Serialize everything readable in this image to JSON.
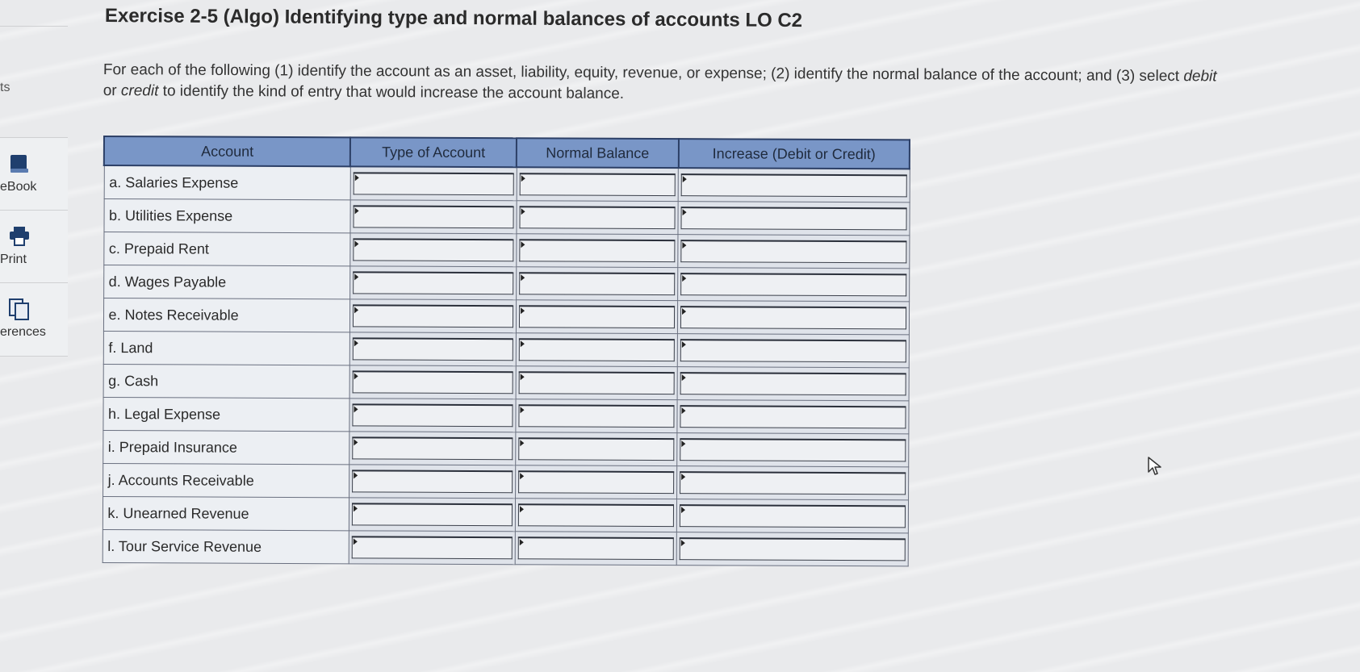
{
  "sidebar": {
    "cut_label_top": "ts",
    "items": [
      {
        "label": "eBook",
        "icon": "book-icon"
      },
      {
        "label": "Print",
        "icon": "printer-icon"
      },
      {
        "label": "erences",
        "icon": "references-icon"
      }
    ]
  },
  "exercise": {
    "title": "Exercise 2-5 (Algo) Identifying type and normal balances of accounts LO C2",
    "instructions_part1": "For each of the following (1) identify the account as an asset, liability, equity, revenue, or expense; (2) identify the normal balance of the account; and (3) select ",
    "instructions_debit": "debit",
    "instructions_or": " or ",
    "instructions_credit": "credit",
    "instructions_part2": " to identify the kind of entry that would increase the account balance."
  },
  "table": {
    "headers": [
      "Account",
      "Type of Account",
      "Normal Balance",
      "Increase (Debit or Credit)"
    ],
    "rows": [
      {
        "account": "a. Salaries Expense",
        "type": "",
        "normal": "",
        "increase": ""
      },
      {
        "account": "b. Utilities Expense",
        "type": "",
        "normal": "",
        "increase": ""
      },
      {
        "account": "c. Prepaid Rent",
        "type": "",
        "normal": "",
        "increase": ""
      },
      {
        "account": "d. Wages Payable",
        "type": "",
        "normal": "",
        "increase": ""
      },
      {
        "account": "e. Notes Receivable",
        "type": "",
        "normal": "",
        "increase": ""
      },
      {
        "account": "f. Land",
        "type": "",
        "normal": "",
        "increase": ""
      },
      {
        "account": "g. Cash",
        "type": "",
        "normal": "",
        "increase": ""
      },
      {
        "account": "h. Legal Expense",
        "type": "",
        "normal": "",
        "increase": ""
      },
      {
        "account": "i. Prepaid Insurance",
        "type": "",
        "normal": "",
        "increase": ""
      },
      {
        "account": "j. Accounts Receivable",
        "type": "",
        "normal": "",
        "increase": ""
      },
      {
        "account": "k. Unearned Revenue",
        "type": "",
        "normal": "",
        "increase": ""
      },
      {
        "account": "l. Tour Service Revenue",
        "type": "",
        "normal": "",
        "increase": ""
      }
    ]
  },
  "colors": {
    "header_bg": "#7996c7",
    "header_border": "#2c3f66",
    "page_bg": "#e9eaec"
  }
}
